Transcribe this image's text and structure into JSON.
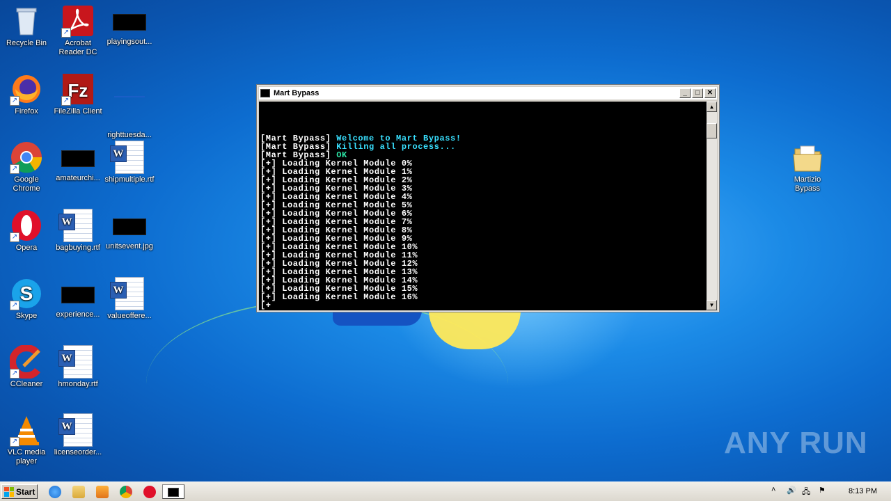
{
  "desktop": {
    "icons": [
      {
        "label": "Recycle Bin"
      },
      {
        "label": "Acrobat Reader DC"
      },
      {
        "label": "playingsout..."
      },
      {
        "label": "Firefox"
      },
      {
        "label": "FileZilla Client"
      },
      {
        "label": "righttuesda..."
      },
      {
        "label": "Google Chrome"
      },
      {
        "label": "amateurchi..."
      },
      {
        "label": "shipmultiple.rtf"
      },
      {
        "label": "Opera"
      },
      {
        "label": "bagbuying.rtf"
      },
      {
        "label": "unitsevent.jpg"
      },
      {
        "label": "Skype"
      },
      {
        "label": "experience..."
      },
      {
        "label": "valueoffere..."
      },
      {
        "label": "CCleaner"
      },
      {
        "label": "hmonday.rtf"
      },
      {
        "label": "VLC media player"
      },
      {
        "label": "licenseorder..."
      },
      {
        "label": "Martizio Bypass"
      }
    ],
    "watermark": "ANY RUN"
  },
  "window": {
    "title": "Mart Bypass",
    "minimize": "_",
    "maximize": "□",
    "close": "✕",
    "lines": [
      {
        "prefix": "[Mart Bypass]",
        "text": " Welcome to Mart Bypass!"
      },
      {
        "prefix": "[Mart Bypass]",
        "text": " Killing all process..."
      },
      {
        "prefix": "[Mart Bypass]",
        "text": " OK"
      },
      {
        "prefix": "",
        "text": "[+] Loading Kernel Module 0%"
      },
      {
        "prefix": "",
        "text": "[+] Loading Kernel Module 1%"
      },
      {
        "prefix": "",
        "text": "[+] Loading Kernel Module 2%"
      },
      {
        "prefix": "",
        "text": "[+] Loading Kernel Module 3%"
      },
      {
        "prefix": "",
        "text": "[+] Loading Kernel Module 4%"
      },
      {
        "prefix": "",
        "text": "[+] Loading Kernel Module 5%"
      },
      {
        "prefix": "",
        "text": "[+] Loading Kernel Module 6%"
      },
      {
        "prefix": "",
        "text": "[+] Loading Kernel Module 7%"
      },
      {
        "prefix": "",
        "text": "[+] Loading Kernel Module 8%"
      },
      {
        "prefix": "",
        "text": "[+] Loading Kernel Module 9%"
      },
      {
        "prefix": "",
        "text": "[+] Loading Kernel Module 10%"
      },
      {
        "prefix": "",
        "text": "[+] Loading Kernel Module 11%"
      },
      {
        "prefix": "",
        "text": "[+] Loading Kernel Module 12%"
      },
      {
        "prefix": "",
        "text": "[+] Loading Kernel Module 13%"
      },
      {
        "prefix": "",
        "text": "[+] Loading Kernel Module 14%"
      },
      {
        "prefix": "",
        "text": "[+] Loading Kernel Module 15%"
      },
      {
        "prefix": "",
        "text": "[+] Loading Kernel Module 16%"
      },
      {
        "prefix": "",
        "text": "[+"
      }
    ]
  },
  "taskbar": {
    "start_label": "Start",
    "clock": "8:13 PM"
  },
  "colors": {
    "console_bg": "#000000",
    "prefix_white": "#ffffff",
    "cyan_text": "#39e0ff",
    "green_text": "#2ce6a6"
  }
}
